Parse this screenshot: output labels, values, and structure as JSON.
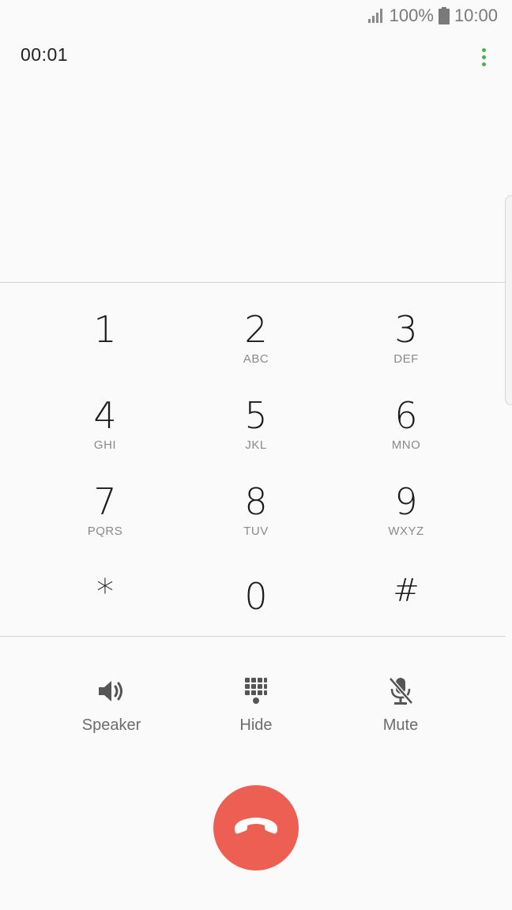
{
  "status_bar": {
    "signal_icon": "signal-bars-icon",
    "battery_text": "100%",
    "battery_icon": "battery-icon",
    "time": "10:00"
  },
  "call": {
    "timer": "00:01",
    "menu_icon": "more-vertical-icon",
    "accent_color": "#4caf50"
  },
  "keypad": {
    "keys": [
      {
        "digit": "1",
        "letters": ""
      },
      {
        "digit": "2",
        "letters": "ABC"
      },
      {
        "digit": "3",
        "letters": "DEF"
      },
      {
        "digit": "4",
        "letters": "GHI"
      },
      {
        "digit": "5",
        "letters": "JKL"
      },
      {
        "digit": "6",
        "letters": "MNO"
      },
      {
        "digit": "7",
        "letters": "PQRS"
      },
      {
        "digit": "8",
        "letters": "TUV"
      },
      {
        "digit": "9",
        "letters": "WXYZ"
      },
      {
        "digit": "*",
        "letters": ""
      },
      {
        "digit": "0",
        "letters": ""
      },
      {
        "digit": "#",
        "letters": ""
      }
    ]
  },
  "actions": {
    "speaker": {
      "label": "Speaker",
      "icon": "speaker-icon"
    },
    "hide": {
      "label": "Hide",
      "icon": "keypad-icon"
    },
    "mute": {
      "label": "Mute",
      "icon": "mic-off-icon"
    }
  },
  "end_call": {
    "icon": "phone-hangup-icon",
    "color": "#ec5f52"
  }
}
